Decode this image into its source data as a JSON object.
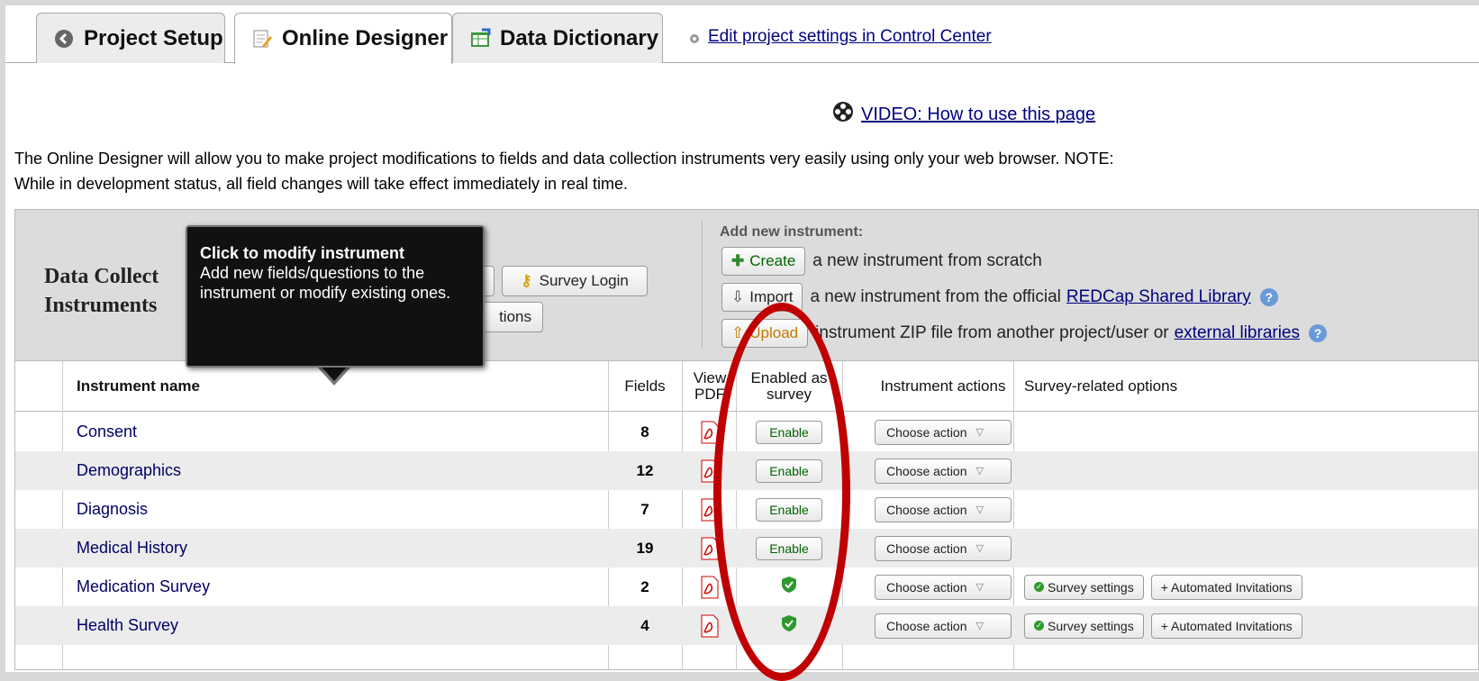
{
  "tabs": [
    {
      "label": "Project Setup",
      "icon": "back-arrow-icon"
    },
    {
      "label": "Online Designer",
      "icon": "pencil-page-icon"
    },
    {
      "label": "Data Dictionary",
      "icon": "spreadsheet-icon"
    }
  ],
  "control_center_link": "Edit project settings in Control Center",
  "video_link": "VIDEO: How to use this page",
  "intro_text": "The Online Designer will allow you to make project modifications to fields and data collection instruments very easily using only your web browser. NOTE: While in development status, all field changes will take effect immediately in real time.",
  "panel": {
    "title_line1": "Data Collect",
    "title_line2": "Instruments",
    "survey_login_label": "Survey Login",
    "partial_button_label": "tions"
  },
  "add_new": {
    "heading": "Add new instrument:",
    "create_label": "Create",
    "create_text": "a new instrument from scratch",
    "import_label": "Import",
    "import_text": "a new instrument from the official",
    "shared_library_link": "REDCap Shared Library",
    "upload_label": "Upload",
    "upload_text": "instrument ZIP file from another project/user or",
    "external_link": "external libraries"
  },
  "table": {
    "headers": {
      "instrument": "Instrument name",
      "fields": "Fields",
      "pdf": "View PDF",
      "enabled": "Enabled as survey",
      "actions": "Instrument actions",
      "survey_opts": "Survey-related options"
    },
    "rows": [
      {
        "name": "Consent",
        "fields": "8",
        "survey": "enable"
      },
      {
        "name": "Demographics",
        "fields": "12",
        "survey": "enable"
      },
      {
        "name": "Diagnosis",
        "fields": "7",
        "survey": "enable"
      },
      {
        "name": "Medical History",
        "fields": "19",
        "survey": "enable"
      },
      {
        "name": "Medication Survey",
        "fields": "2",
        "survey": "enabled"
      },
      {
        "name": "Health Survey",
        "fields": "4",
        "survey": "enabled"
      }
    ],
    "enable_label": "Enable",
    "choose_action_label": "Choose action",
    "survey_settings_label": "Survey settings",
    "auto_invites_label": "+ Automated Invitations"
  },
  "tooltip": {
    "title": "Click to modify instrument",
    "body": "Add new fields/questions to the instrument or modify existing ones."
  },
  "colors": {
    "annotation": "#c00000",
    "link": "#000080"
  }
}
